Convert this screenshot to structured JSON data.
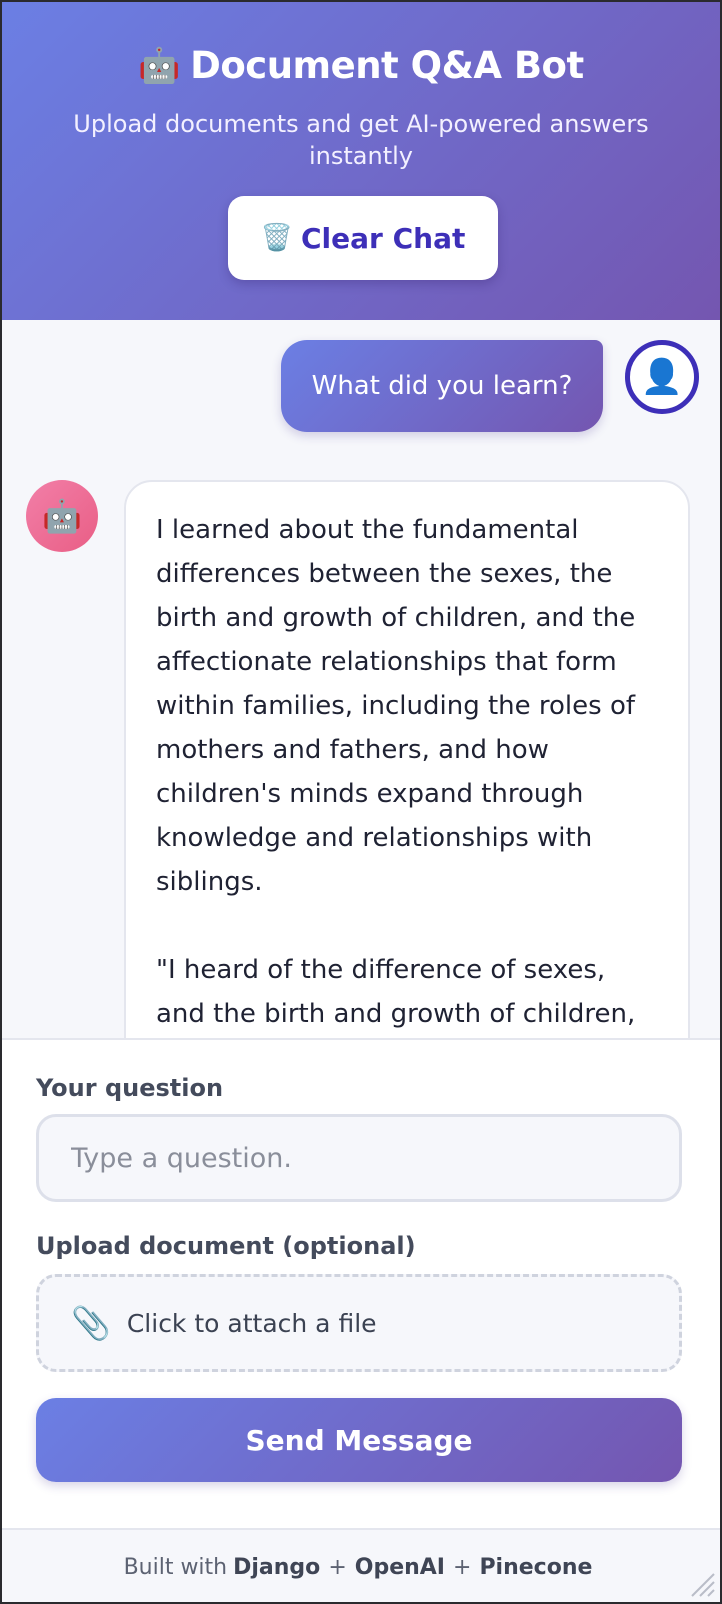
{
  "header": {
    "robot_emoji": "🤖",
    "title": "Document Q&A Bot",
    "subtitle": "Upload documents and get AI-powered answers instantly",
    "clear_icon": "🗑️",
    "clear_label": "Clear Chat"
  },
  "chat": {
    "user_message": "What did you learn?",
    "user_avatar": "👤",
    "bot_avatar": "🤖",
    "bot_message": "I learned about the fundamental differences between the sexes, the birth and growth of children, and the affectionate relationships that form within families, including the roles of mothers and fathers, and how children's minds expand through knowledge and relationships with siblings.\n\n\"I heard of the difference of sexes, and the birth and growth of children,"
  },
  "form": {
    "question_label": "Your question",
    "question_placeholder": "Type a question.",
    "question_value": "",
    "upload_label": "Upload document (optional)",
    "upload_icon": "📎",
    "upload_text": "Click to attach a file",
    "send_label": "Send Message"
  },
  "footer": {
    "prefix": "Built with",
    "tech1": "Django",
    "plus1": "+",
    "tech2": "OpenAI",
    "plus2": "+",
    "tech3": "Pinecone"
  },
  "colors": {
    "gradient_start": "#6b7fe4",
    "gradient_end": "#7456b0",
    "accent": "#3d2fb8",
    "bot_avatar": "#ec6b93"
  }
}
